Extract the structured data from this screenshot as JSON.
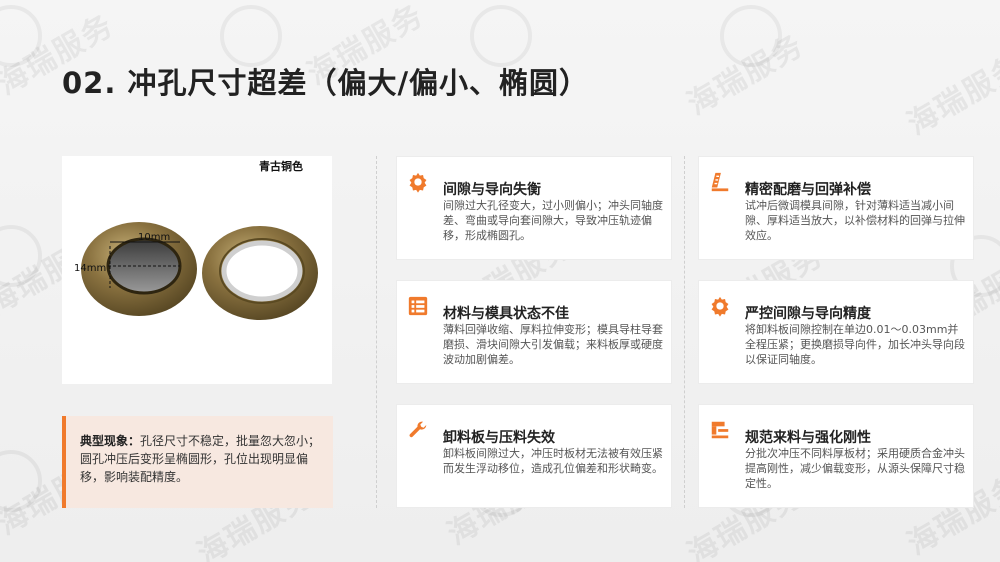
{
  "title": "02. 冲孔尺寸超差（偏大/偏小、椭圆）",
  "watermark": "海瑞服务",
  "photo": {
    "caption": "青古铜色",
    "dim_width": "10mm",
    "dim_height": "14mm"
  },
  "summary": {
    "label": "典型现象：",
    "text": "孔径尺寸不稳定，批量忽大忽小；圆孔冲压后变形呈椭圆形，孔位出现明显偏移，影响装配精度。"
  },
  "cards": [
    {
      "icon": "gear-icon",
      "title": "间隙与导向失衡",
      "body": "间隙过大孔径变大，过小则偏小；冲头同轴度差、弯曲或导向套间隙大，导致冲压轨迹偏移，形成椭圆孔。"
    },
    {
      "icon": "ruler-icon",
      "title": "精密配磨与回弹补偿",
      "body": "试冲后微调模具间隙，针对薄料适当减小间隙、厚料适当放大，以补偿材料的回弹与拉伸效应。"
    },
    {
      "icon": "grid-icon",
      "title": "材料与模具状态不佳",
      "body": "薄料回弹收缩、厚料拉伸变形；模具导柱导套磨损、滑块间隙大引发偏载；来料板厚或硬度波动加剧偏差。"
    },
    {
      "icon": "gear-icon",
      "title": "严控间隙与导向精度",
      "body": "将卸料板间隙控制在单边0.01～0.03mm并全程压紧；更换磨损导向件，加长冲头导向段以保证同轴度。"
    },
    {
      "icon": "wrench-icon",
      "title": "卸料板与压料失效",
      "body": "卸料板间隙过大，冲压时板材无法被有效压紧而发生浮动移位，造成孔位偏差和形状畸变。"
    },
    {
      "icon": "vise-icon",
      "title": "规范来料与强化刚性",
      "body": "分批次冲压不同料厚板材；采用硬质合金冲头提高刚性，减少偏载变形，从源头保障尺寸稳定性。"
    }
  ],
  "colors": {
    "accent": "#f07a2c",
    "summary_bg": "#f7e8e0"
  }
}
